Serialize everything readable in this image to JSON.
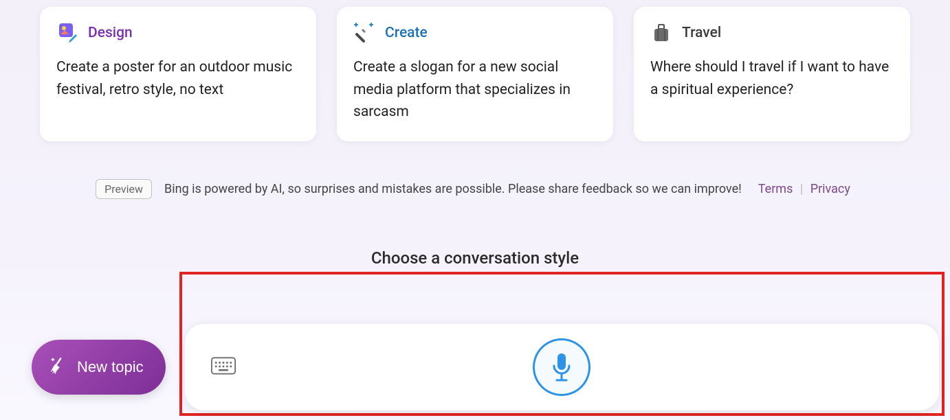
{
  "cards": [
    {
      "category": "Design",
      "prompt": "Create a poster for an outdoor music festival, retro style, no text"
    },
    {
      "category": "Create",
      "prompt": "Create a slogan for a new social media platform that specializes in sarcasm"
    },
    {
      "category": "Travel",
      "prompt": "Where should I travel if I want to have a spiritual experience?"
    }
  ],
  "preview_badge": "Preview",
  "disclaimer_text": "Bing is powered by AI, so surprises and mistakes are possible. Please share feedback so we can improve!",
  "links": {
    "terms": "Terms",
    "privacy": "Privacy"
  },
  "style_heading": "Choose a conversation style",
  "new_topic_label": "New topic"
}
